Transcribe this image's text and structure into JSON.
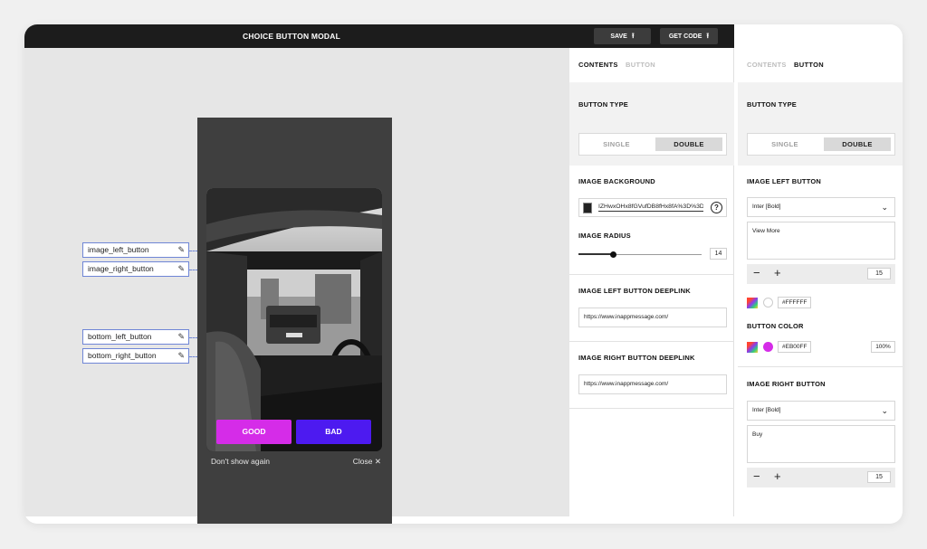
{
  "topbar": {
    "title": "CHOICE BUTTON MODAL",
    "save_label": "SAVE",
    "get_code_label": "GET CODE"
  },
  "canvas": {
    "layer_labels": [
      "image_left_button",
      "image_right_button",
      "bottom_left_button",
      "bottom_right_button"
    ],
    "buttons": {
      "left_label": "GOOD",
      "right_label": "BAD",
      "left_color": "#D52CE8",
      "right_color": "#4D1AF0"
    },
    "dont_show_label": "Don't show again",
    "close_label": "Close ✕"
  },
  "contents_panel": {
    "tabs": [
      "CONTENTS",
      "BUTTON"
    ],
    "active_tab": "CONTENTS",
    "button_type": {
      "title": "BUTTON TYPE",
      "options": [
        "SINGLE",
        "DOUBLE"
      ],
      "selected": "DOUBLE"
    },
    "image_background": {
      "title": "IMAGE BACKGROUND",
      "value": "IZHwxOHx8fGVufDB8fHx8fA%3D%3D"
    },
    "image_radius": {
      "title": "IMAGE RADIUS",
      "value": "14",
      "fraction": 0.28
    },
    "left_deeplink": {
      "title": "IMAGE LEFT BUTTON DEEPLINK",
      "value": "https://www.inappmessage.com/"
    },
    "right_deeplink": {
      "title": "IMAGE RIGHT BUTTON DEEPLINK",
      "value": "https://www.inappmessage.com/"
    }
  },
  "button_panel": {
    "tabs": [
      "CONTENTS",
      "BUTTON"
    ],
    "active_tab": "BUTTON",
    "button_type": {
      "title": "BUTTON TYPE",
      "options": [
        "SINGLE",
        "DOUBLE"
      ],
      "selected": "DOUBLE"
    },
    "left_button": {
      "title": "IMAGE LEFT BUTTON",
      "font": "Inter [Bold]",
      "text": "View More",
      "size": "15",
      "text_color": "#FFFFFF",
      "button_color_title": "BUTTON COLOR",
      "button_color": "#EB00FF",
      "opacity": "100%"
    },
    "right_button": {
      "title": "IMAGE RIGHT BUTTON",
      "font": "Inter [Bold]",
      "text": "Buy",
      "size": "15"
    }
  },
  "icons": {
    "pencil": "pencil-icon",
    "help": "help-circle-icon",
    "chevron": "chevron-down-icon",
    "upload": "upload-icon"
  }
}
